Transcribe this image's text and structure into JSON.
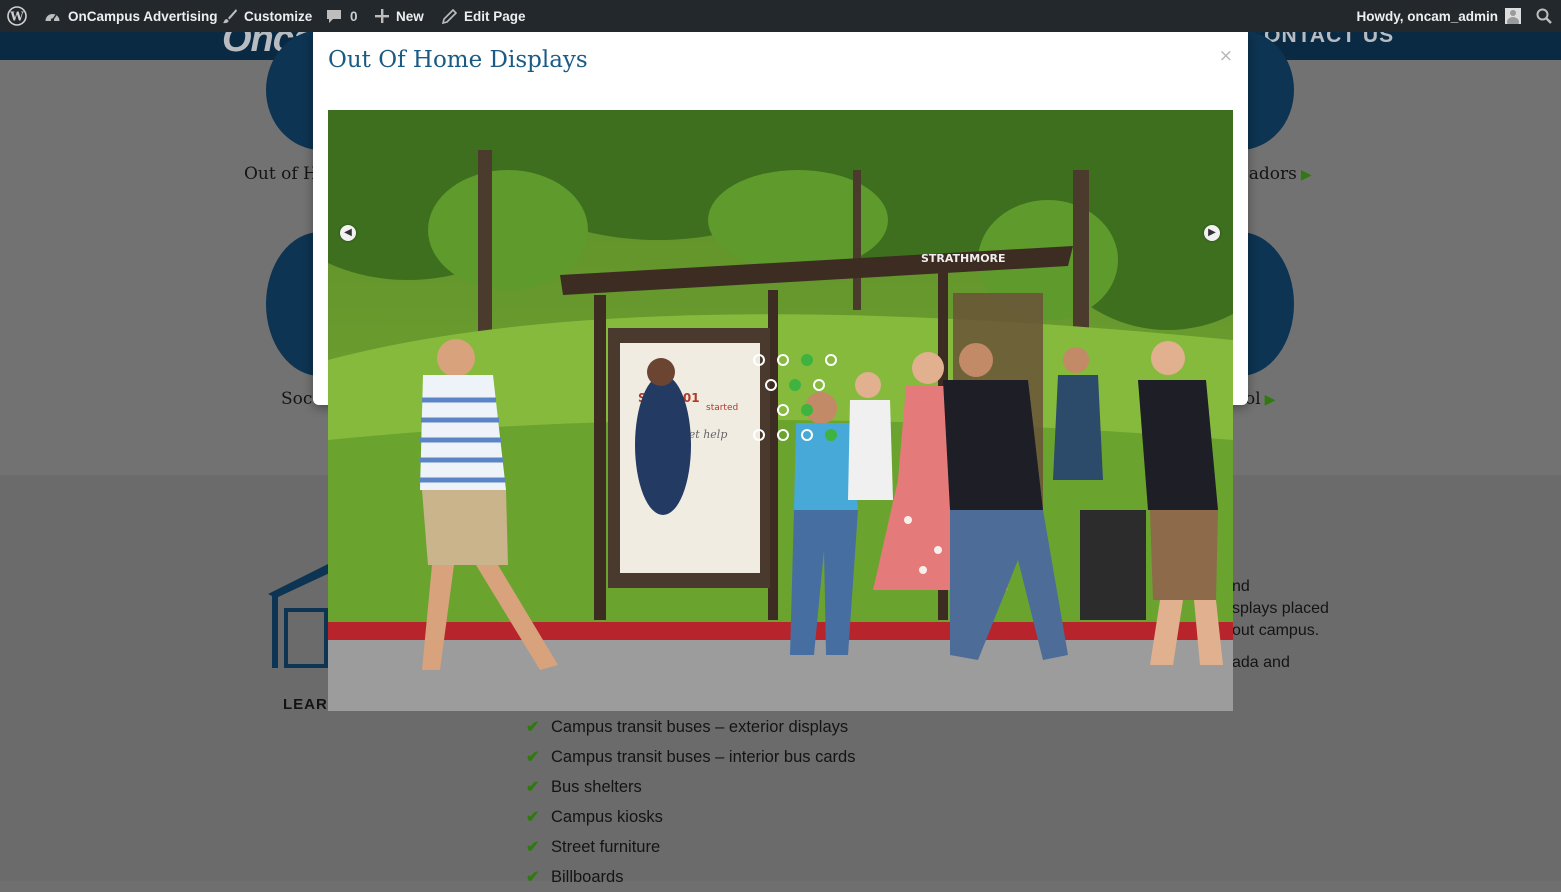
{
  "admin_bar": {
    "site_name": "OnCampus Advertising",
    "customize": "Customize",
    "comments_count": "0",
    "new": "New",
    "edit_page": "Edit Page",
    "howdy": "Howdy, oncam_admin"
  },
  "background": {
    "header_logo_fragment": "Oncam",
    "header_nav_fragment": "CONTACT US",
    "services": {
      "out_of_home": "Out of H",
      "ambassadors": "sadors",
      "social": "Soc",
      "school": "ol"
    },
    "learn_more": "LEARN MORE",
    "side_lines": [
      "nd",
      "splays placed",
      "out campus.",
      "ada and"
    ],
    "features": [
      "Campus transit buses – exterior displays",
      "Campus transit buses – interior bus cards",
      "Bus shelters",
      "Campus kiosks",
      "Street furniture",
      "Billboards"
    ]
  },
  "modal": {
    "title": "Out Of Home Displays",
    "close": "×"
  },
  "slide": {
    "shelter_sign": "STRATHMORE",
    "poster_text_1": "Scan 101",
    "poster_text_2": "started",
    "poster_text_3": "Get help"
  },
  "colors": {
    "admin_bar": "#23282d",
    "title_blue": "#1a5b86",
    "check_green": "#2f7a0e",
    "loader_green": "#3fb33f"
  }
}
